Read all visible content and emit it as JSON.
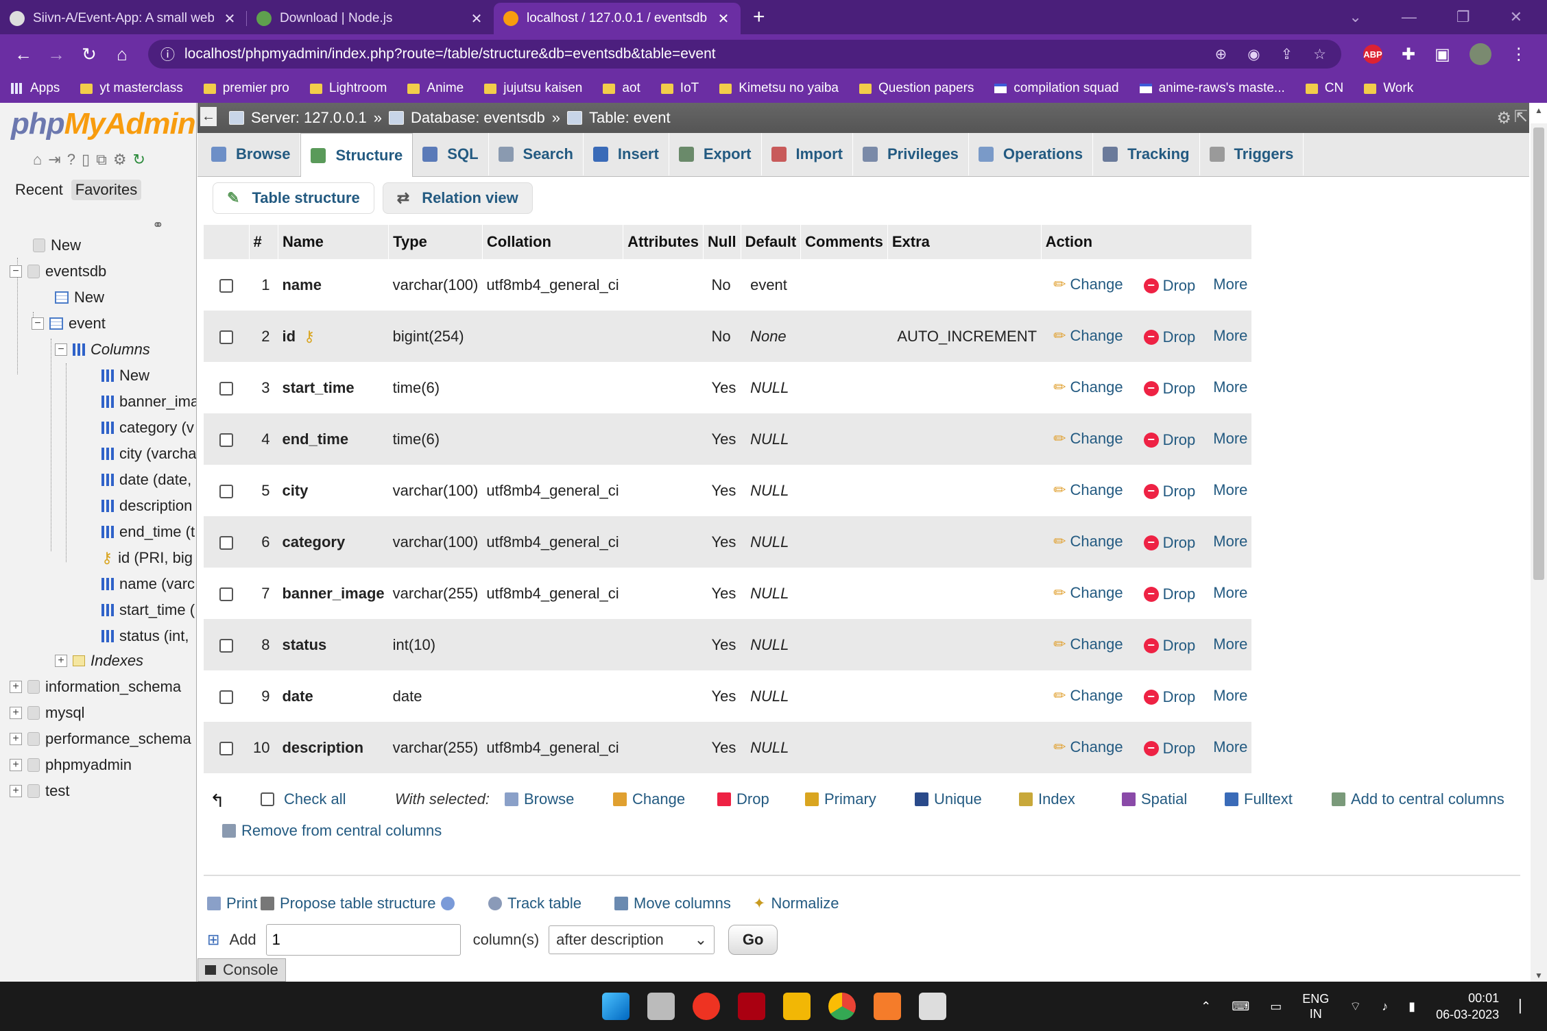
{
  "browser": {
    "tabs": [
      {
        "title": "Siivn-A/Event-App: A small web a",
        "close": "✕",
        "fav": "#ddd"
      },
      {
        "title": "Download | Node.js",
        "close": "✕",
        "fav": "#5fa04e"
      },
      {
        "title": "localhost / 127.0.0.1 / eventsdb /",
        "close": "✕",
        "fav": "#f89c0e"
      }
    ],
    "new_tab": "+",
    "url": "localhost/phpmyadmin/index.php?route=/table/structure&db=eventsdb&table=event",
    "abp": "ABP",
    "bookmarks": [
      {
        "label": "Apps",
        "icon": "grid"
      },
      {
        "label": "yt masterclass",
        "icon": "folder"
      },
      {
        "label": "premier pro",
        "icon": "folder"
      },
      {
        "label": "Lightroom",
        "icon": "folder"
      },
      {
        "label": "Anime",
        "icon": "folder"
      },
      {
        "label": "jujutsu kaisen",
        "icon": "folder"
      },
      {
        "label": "aot",
        "icon": "folder"
      },
      {
        "label": "IoT",
        "icon": "folder"
      },
      {
        "label": "Kimetsu no yaiba",
        "icon": "folder"
      },
      {
        "label": "Question papers",
        "icon": "folder"
      },
      {
        "label": "compilation squad",
        "icon": "cs"
      },
      {
        "label": "anime-raws's maste...",
        "icon": "cs"
      },
      {
        "label": "CN",
        "icon": "folder"
      },
      {
        "label": "Work",
        "icon": "folder"
      }
    ]
  },
  "sidebar": {
    "logo_php": "php",
    "logo_my": "MyAdmin",
    "recent": "Recent",
    "favorites": "Favorites",
    "tree": {
      "new": "New",
      "eventsdb": "eventsdb",
      "db_new": "New",
      "event": "event",
      "columns": "Columns",
      "col_new": "New",
      "cols": [
        "banner_ima",
        "category (v",
        "city (varcha",
        "date (date,",
        "description",
        "end_time (t",
        "id (PRI, big",
        "name (varc",
        "start_time (",
        "status (int,"
      ],
      "indexes": "Indexes",
      "other_dbs": [
        "information_schema",
        "mysql",
        "performance_schema",
        "phpmyadmin",
        "test"
      ]
    }
  },
  "breadcrumb": {
    "back": "←",
    "server": "Server: 127.0.0.1",
    "sep": "»",
    "database": "Database: eventsdb",
    "table": "Table: event"
  },
  "tabs": [
    {
      "label": "Browse",
      "color": "#6d8fc7"
    },
    {
      "label": "Structure",
      "color": "#5a9a5a"
    },
    {
      "label": "SQL",
      "color": "#5a7ab8"
    },
    {
      "label": "Search",
      "color": "#8a9ab0"
    },
    {
      "label": "Insert",
      "color": "#3a6bb8"
    },
    {
      "label": "Export",
      "color": "#6a8a6a"
    },
    {
      "label": "Import",
      "color": "#c85a5a"
    },
    {
      "label": "Privileges",
      "color": "#7a8aa8"
    },
    {
      "label": "Operations",
      "color": "#7a9ac8"
    },
    {
      "label": "Tracking",
      "color": "#6a7a9a"
    },
    {
      "label": "Triggers",
      "color": "#9a9a9a"
    }
  ],
  "subtabs": {
    "table_structure": "Table structure",
    "relation_view": "Relation view"
  },
  "structure": {
    "headers": [
      "#",
      "Name",
      "Type",
      "Collation",
      "Attributes",
      "Null",
      "Default",
      "Comments",
      "Extra",
      "Action"
    ],
    "rows": [
      {
        "num": "1",
        "name": "name",
        "key": false,
        "type": "varchar(100)",
        "collation": "utf8mb4_general_ci",
        "null": "No",
        "default": "event",
        "default_italic": false,
        "extra": ""
      },
      {
        "num": "2",
        "name": "id",
        "key": true,
        "type": "bigint(254)",
        "collation": "",
        "null": "No",
        "default": "None",
        "default_italic": true,
        "extra": "AUTO_INCREMENT"
      },
      {
        "num": "3",
        "name": "start_time",
        "key": false,
        "type": "time(6)",
        "collation": "",
        "null": "Yes",
        "default": "NULL",
        "default_italic": true,
        "extra": ""
      },
      {
        "num": "4",
        "name": "end_time",
        "key": false,
        "type": "time(6)",
        "collation": "",
        "null": "Yes",
        "default": "NULL",
        "default_italic": true,
        "extra": ""
      },
      {
        "num": "5",
        "name": "city",
        "key": false,
        "type": "varchar(100)",
        "collation": "utf8mb4_general_ci",
        "null": "Yes",
        "default": "NULL",
        "default_italic": true,
        "extra": ""
      },
      {
        "num": "6",
        "name": "category",
        "key": false,
        "type": "varchar(100)",
        "collation": "utf8mb4_general_ci",
        "null": "Yes",
        "default": "NULL",
        "default_italic": true,
        "extra": ""
      },
      {
        "num": "7",
        "name": "banner_image",
        "key": false,
        "type": "varchar(255)",
        "collation": "utf8mb4_general_ci",
        "null": "Yes",
        "default": "NULL",
        "default_italic": true,
        "extra": ""
      },
      {
        "num": "8",
        "name": "status",
        "key": false,
        "type": "int(10)",
        "collation": "",
        "null": "Yes",
        "default": "NULL",
        "default_italic": true,
        "extra": ""
      },
      {
        "num": "9",
        "name": "date",
        "key": false,
        "type": "date",
        "collation": "",
        "null": "Yes",
        "default": "NULL",
        "default_italic": true,
        "extra": ""
      },
      {
        "num": "10",
        "name": "description",
        "key": false,
        "type": "varchar(255)",
        "collation": "utf8mb4_general_ci",
        "null": "Yes",
        "default": "NULL",
        "default_italic": true,
        "extra": ""
      }
    ],
    "actions": {
      "change": "Change",
      "drop": "Drop",
      "more": "More"
    }
  },
  "with_selected": {
    "check_all": "Check all",
    "label": "With selected:",
    "items": [
      "Browse",
      "Change",
      "Drop",
      "Primary",
      "Unique",
      "Index",
      "Spatial",
      "Fulltext",
      "Add to central columns",
      "Remove from central columns"
    ]
  },
  "bottom_ops": {
    "print": "Print",
    "propose": "Propose table structure",
    "track": "Track table",
    "move": "Move columns",
    "normalize": "Normalize"
  },
  "add_row": {
    "add": "Add",
    "count": "1",
    "columns_label": "column(s)",
    "position": "after description",
    "go": "Go"
  },
  "console": "Console",
  "taskbar": {
    "lang1": "ENG",
    "lang2": "IN",
    "time": "00:01",
    "date": "06-03-2023"
  }
}
